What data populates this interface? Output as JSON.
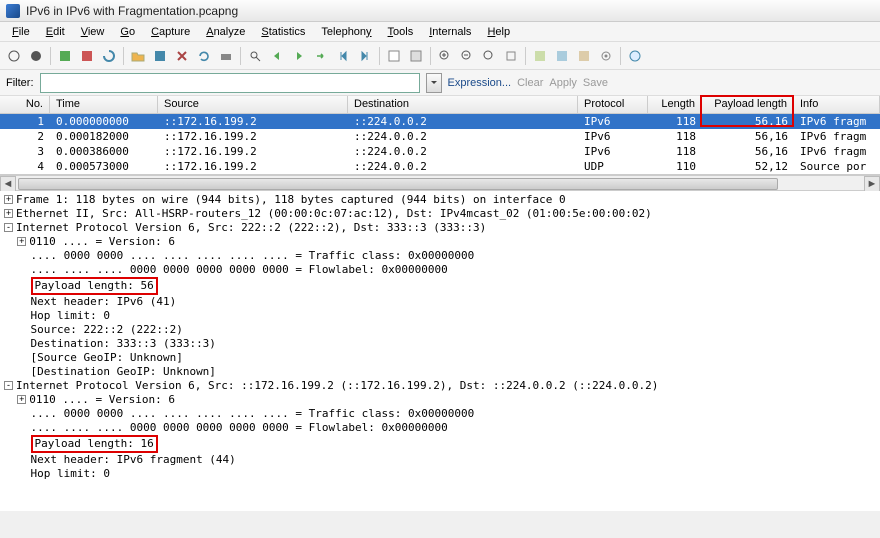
{
  "window": {
    "title": "IPv6 in IPv6 with Fragmentation.pcapng"
  },
  "menu": [
    "File",
    "Edit",
    "View",
    "Go",
    "Capture",
    "Analyze",
    "Statistics",
    "Telephony",
    "Tools",
    "Internals",
    "Help"
  ],
  "filter": {
    "label": "Filter:",
    "value": "",
    "expression": "Expression...",
    "clear": "Clear",
    "apply": "Apply",
    "save": "Save"
  },
  "columns": [
    "No.",
    "Time",
    "Source",
    "Destination",
    "Protocol",
    "Length",
    "Payload length",
    "Info"
  ],
  "packets": [
    {
      "no": "1",
      "time": "0.000000000",
      "src": "::172.16.199.2",
      "dst": "::224.0.0.2",
      "proto": "IPv6",
      "len": "118",
      "plen": "56,16",
      "info": "IPv6 fragm"
    },
    {
      "no": "2",
      "time": "0.000182000",
      "src": "::172.16.199.2",
      "dst": "::224.0.0.2",
      "proto": "IPv6",
      "len": "118",
      "plen": "56,16",
      "info": "IPv6 fragm"
    },
    {
      "no": "3",
      "time": "0.000386000",
      "src": "::172.16.199.2",
      "dst": "::224.0.0.2",
      "proto": "IPv6",
      "len": "118",
      "plen": "56,16",
      "info": "IPv6 fragm"
    },
    {
      "no": "4",
      "time": "0.000573000",
      "src": "::172.16.199.2",
      "dst": "::224.0.0.2",
      "proto": "UDP",
      "len": "110",
      "plen": "52,12",
      "info": "Source por"
    }
  ],
  "details": {
    "frame": "Frame 1: 118 bytes on wire (944 bits), 118 bytes captured (944 bits) on interface 0",
    "eth": "Ethernet II, Src: All-HSRP-routers_12 (00:00:0c:07:ac:12), Dst: IPv4mcast_02 (01:00:5e:00:00:02)",
    "ipv6a": {
      "hdr": "Internet Protocol Version 6, Src: 222::2 (222::2), Dst: 333::3 (333::3)",
      "ver": "0110 .... = Version: 6",
      "tc": ".... 0000 0000 .... .... .... .... .... = Traffic class: 0x00000000",
      "fl": ".... .... .... 0000 0000 0000 0000 0000 = Flowlabel: 0x00000000",
      "plen": "Payload length: 56",
      "nh": "Next header: IPv6 (41)",
      "hop": "Hop limit: 0",
      "src": "Source: 222::2 (222::2)",
      "dst": "Destination: 333::3 (333::3)",
      "sg": "[Source GeoIP: Unknown]",
      "dg": "[Destination GeoIP: Unknown]"
    },
    "ipv6b": {
      "hdr": "Internet Protocol Version 6, Src: ::172.16.199.2 (::172.16.199.2), Dst: ::224.0.0.2 (::224.0.0.2)",
      "ver": "0110 .... = Version: 6",
      "tc": ".... 0000 0000 .... .... .... .... .... = Traffic class: 0x00000000",
      "fl": ".... .... .... 0000 0000 0000 0000 0000 = Flowlabel: 0x00000000",
      "plen": "Payload length: 16",
      "nh": "Next header: IPv6 fragment (44)",
      "hop": "Hop limit: 0"
    }
  },
  "highlight_column": "Payload length"
}
